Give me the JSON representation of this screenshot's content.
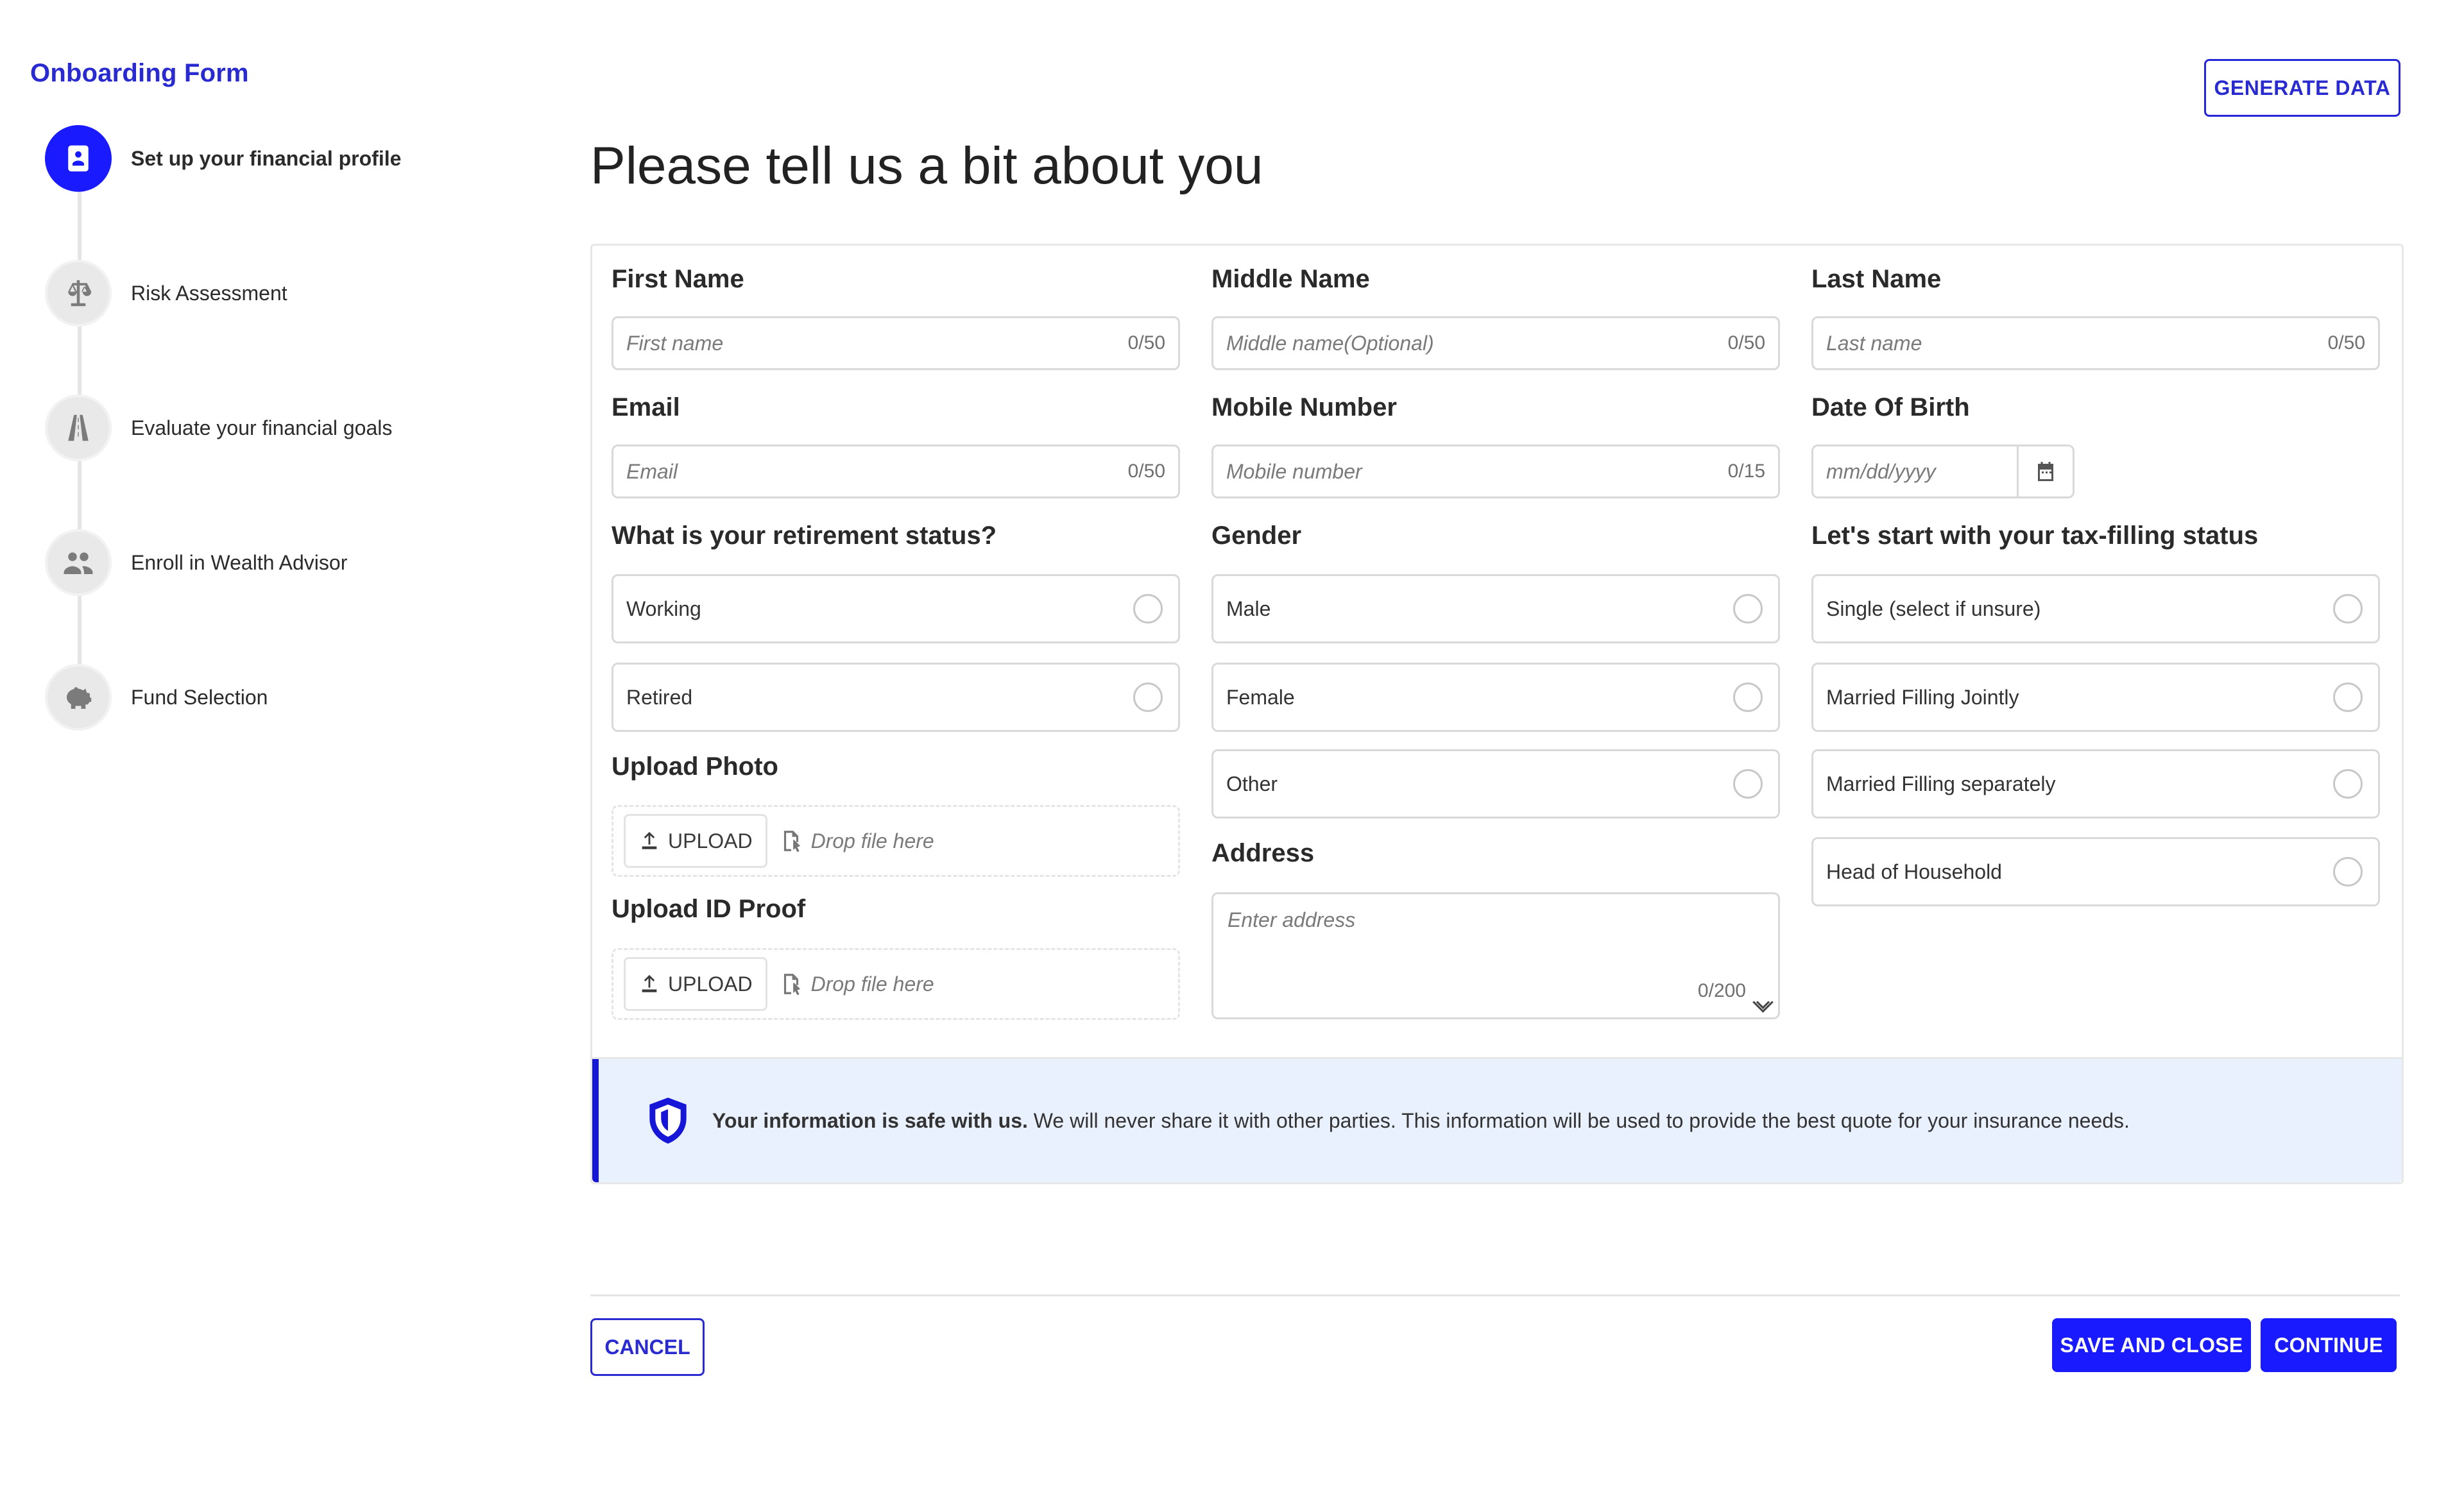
{
  "sidebar": {
    "title": "Onboarding Form",
    "steps": [
      {
        "label": "Set up your financial profile",
        "icon": "profile-icon"
      },
      {
        "label": "Risk Assessment",
        "icon": "scale-icon"
      },
      {
        "label": "Evaluate your financial goals",
        "icon": "road-icon"
      },
      {
        "label": "Enroll in Wealth Advisor",
        "icon": "people-icon"
      },
      {
        "label": "Fund Selection",
        "icon": "piggy-bank-icon"
      }
    ]
  },
  "header": {
    "generate_label": "GENERATE DATA",
    "title": "Please tell us a bit about you"
  },
  "form": {
    "first_name": {
      "label": "First Name",
      "placeholder": "First name",
      "count": "0/50"
    },
    "middle_name": {
      "label": "Middle Name",
      "placeholder": "Middle name(Optional)",
      "count": "0/50"
    },
    "last_name": {
      "label": "Last Name",
      "placeholder": "Last name",
      "count": "0/50"
    },
    "email": {
      "label": "Email",
      "placeholder": "Email",
      "count": "0/50"
    },
    "mobile": {
      "label": "Mobile Number",
      "placeholder": "Mobile number",
      "count": "0/15"
    },
    "dob": {
      "label": "Date Of Birth",
      "placeholder": "mm/dd/yyyy"
    },
    "retirement": {
      "label": "What is your retirement status?",
      "options": [
        "Working",
        "Retired"
      ]
    },
    "gender": {
      "label": "Gender",
      "options": [
        "Male",
        "Female",
        "Other"
      ]
    },
    "tax": {
      "label": "Let's start with your tax-filling status",
      "options": [
        "Single (select if unsure)",
        "Married Filling Jointly",
        "Married Filling separately",
        "Head of Household"
      ]
    },
    "upload_photo": {
      "label": "Upload Photo",
      "button": "UPLOAD",
      "drop": "Drop file here"
    },
    "upload_id": {
      "label": "Upload ID Proof",
      "button": "UPLOAD",
      "drop": "Drop file here"
    },
    "address": {
      "label": "Address",
      "placeholder": "Enter address",
      "count": "0/200"
    }
  },
  "info": {
    "bold": "Your information is safe with us.",
    "text": " We will never share it with other parties. This information will be used to provide the best quote for your insurance needs."
  },
  "footer": {
    "cancel": "CANCEL",
    "save": "SAVE AND CLOSE",
    "continue": "CONTINUE"
  },
  "colors": {
    "accent": "#1a1aff",
    "info_bg": "#e9f0fe"
  }
}
